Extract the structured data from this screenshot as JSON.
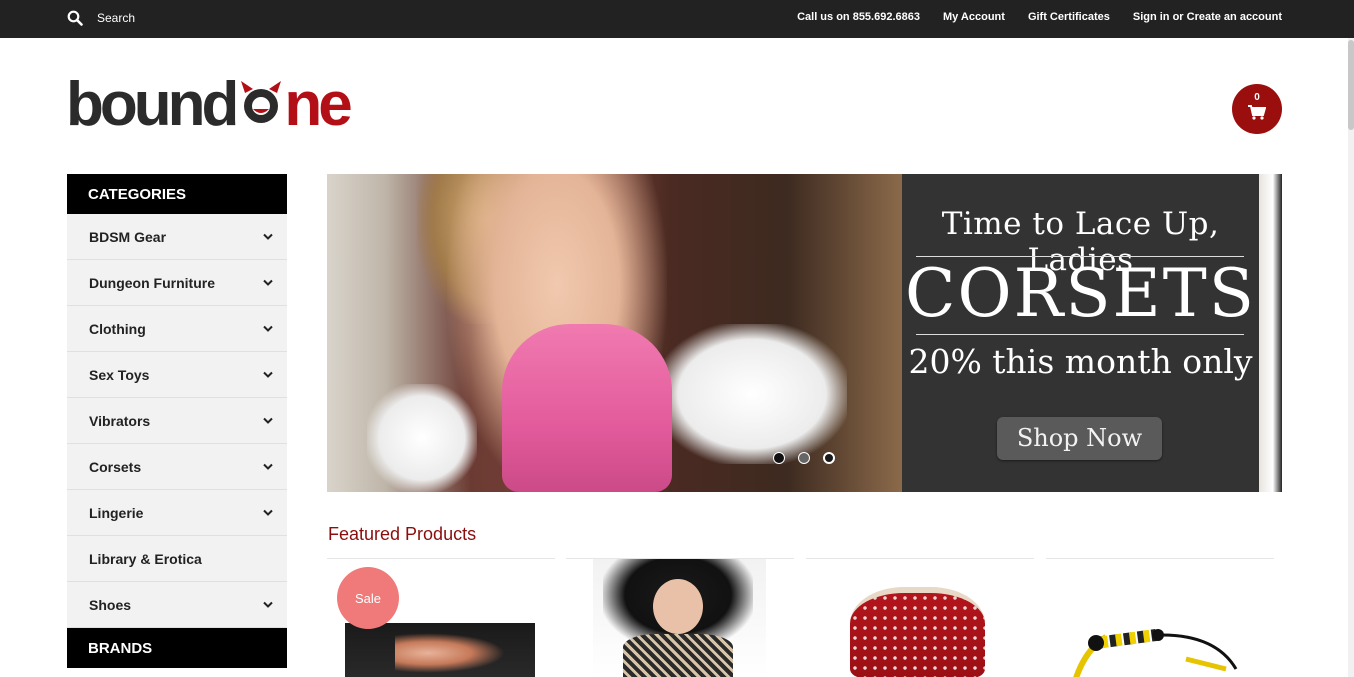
{
  "topbar": {
    "search_label": "Search",
    "links": [
      "Call us on 855.692.6863",
      "My Account",
      "Gift Certificates",
      "Sign in or Create an account"
    ]
  },
  "logo": {
    "part1": "bound",
    "part2": "ne",
    "alt": "boundone"
  },
  "cart": {
    "count": "0"
  },
  "sidebar": {
    "categories_heading": "CATEGORIES",
    "items": [
      {
        "label": "BDSM Gear",
        "has_children": true
      },
      {
        "label": "Dungeon Furniture",
        "has_children": true
      },
      {
        "label": "Clothing",
        "has_children": true
      },
      {
        "label": "Sex Toys",
        "has_children": true
      },
      {
        "label": "Vibrators",
        "has_children": true
      },
      {
        "label": "Corsets",
        "has_children": true
      },
      {
        "label": "Lingerie",
        "has_children": true
      },
      {
        "label": "Library & Erotica",
        "has_children": false
      },
      {
        "label": "Shoes",
        "has_children": true
      }
    ],
    "brands_heading": "BRANDS"
  },
  "banner": {
    "line1": "Time to Lace Up, Ladies",
    "line2": "CORSETS",
    "line3": "20% this month only",
    "button": "Shop Now",
    "slide_count": 3,
    "active_slide": 1
  },
  "featured": {
    "title": "Featured Products",
    "products": [
      {
        "badge": "Sale"
      },
      {
        "badge": ""
      },
      {
        "badge": ""
      },
      {
        "badge": ""
      }
    ]
  },
  "colors": {
    "accent": "#9a0e0e",
    "topbar": "#222222",
    "sale_badge": "#f07a7a",
    "logo_red": "#b30f16"
  }
}
